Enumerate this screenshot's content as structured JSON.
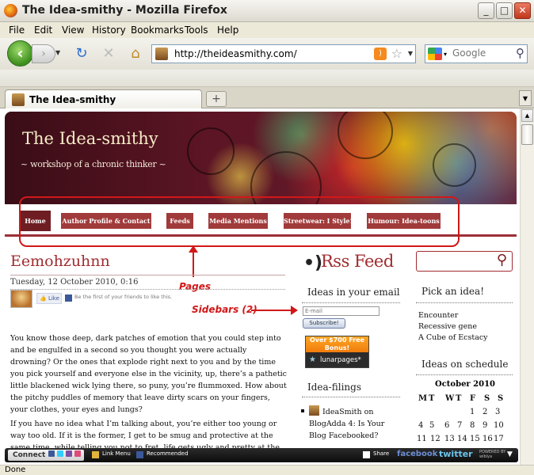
{
  "window": {
    "title": "The Idea-smithy - Mozilla Firefox"
  },
  "menu": [
    "File",
    "Edit",
    "View",
    "History",
    "Bookmarks",
    "Tools",
    "Help"
  ],
  "toolbar": {
    "url": "http://theideasmithy.com/",
    "search_placeholder": "Google"
  },
  "tab": {
    "label": "The Idea-smithy",
    "newtab": "+"
  },
  "site": {
    "title": "The Idea-smithy",
    "tagline": "~ workshop of a chronic thinker ~"
  },
  "nav": [
    "Home",
    "Author Profile & Contact",
    "Feeds",
    "Media Mentions",
    "Streetwear: I Style!",
    "Humour: Idea-toons"
  ],
  "annotations": {
    "pages": "Pages",
    "sidebars": "Sidebars (2)"
  },
  "post": {
    "title": "Eemohzuhnn",
    "date": "Tuesday, 12 October 2010, 0:16",
    "like": "Like",
    "fb_text": "Be the first of your friends to like this.",
    "paragraphs": [
      "You know those deep, dark patches of emotion that you could step into and be engulfed in a second so you thought you were actually drowning? Or the ones that explode right next to you and by the time you pick yourself and everyone else in the vicinity, up, there’s a pathetic little blackened wick lying there, so puny, you’re flummoxed. How about the pitchy puddles of memory that leave dirty scars on your fingers, your clothes, your eyes and lungs?",
      "If you have no idea what I’m talking about, you’re either too young or way too old. If it is the former, I get to be smug and protective at the same time, while telling you not to fret, life gets ugly and pretty at the same"
    ]
  },
  "sidebar1": {
    "rss_title": "Rss Feed",
    "email_heading": "Ideas in your email",
    "email_placeholder": "E-mail",
    "subscribe": "Subscribe!",
    "ad_top": "Over $700 Free Bonus!",
    "ad_brand": "lunarpages*",
    "filings_heading": "Idea-filings",
    "filing": "IdeaSmith on BlogAdda 4: Is Your Blog Facebooked?"
  },
  "sidebar2": {
    "pick_heading": "Pick an idea!",
    "links": [
      "Encounter",
      "Recessive gene",
      "A Cube of Ecstacy"
    ],
    "schedule_heading": "Ideas on schedule",
    "calendar": {
      "month": "October 2010",
      "days": [
        "M",
        "T",
        "W",
        "T",
        "F",
        "S",
        "S"
      ],
      "rows": [
        [
          "",
          "",
          "",
          "",
          "1",
          "2",
          "3"
        ],
        [
          "4",
          "5",
          "6",
          "7",
          "8",
          "9",
          "10"
        ],
        [
          "11",
          "12",
          "13",
          "14",
          "15",
          "16",
          "17"
        ]
      ]
    }
  },
  "wibiya": {
    "connect": "Connect",
    "link_menu": "Link Menu",
    "recommended": "Recommended",
    "share": "Share",
    "facebook": "facebook",
    "twitter": "twitter",
    "powered": "POWERED BY wibiya"
  },
  "status": "Done"
}
